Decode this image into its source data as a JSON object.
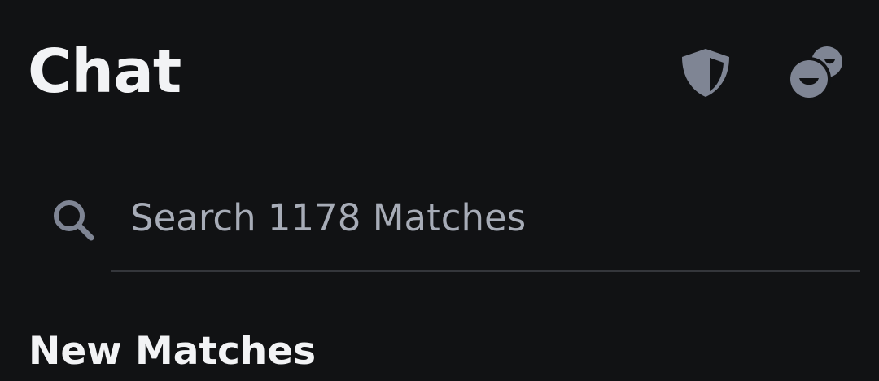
{
  "header": {
    "title": "Chat"
  },
  "icons": {
    "safety": "shield-icon",
    "chat": "chat-bubbles-icon",
    "search": "search-icon"
  },
  "search": {
    "placeholder": "Search 1178 Matches"
  },
  "sections": {
    "new_matches_title": "New Matches"
  },
  "colors": {
    "background": "#111214",
    "title_text": "#f2f3f5",
    "icon": "#7f8594",
    "placeholder": "#a7acb7",
    "divider": "#34363b"
  }
}
